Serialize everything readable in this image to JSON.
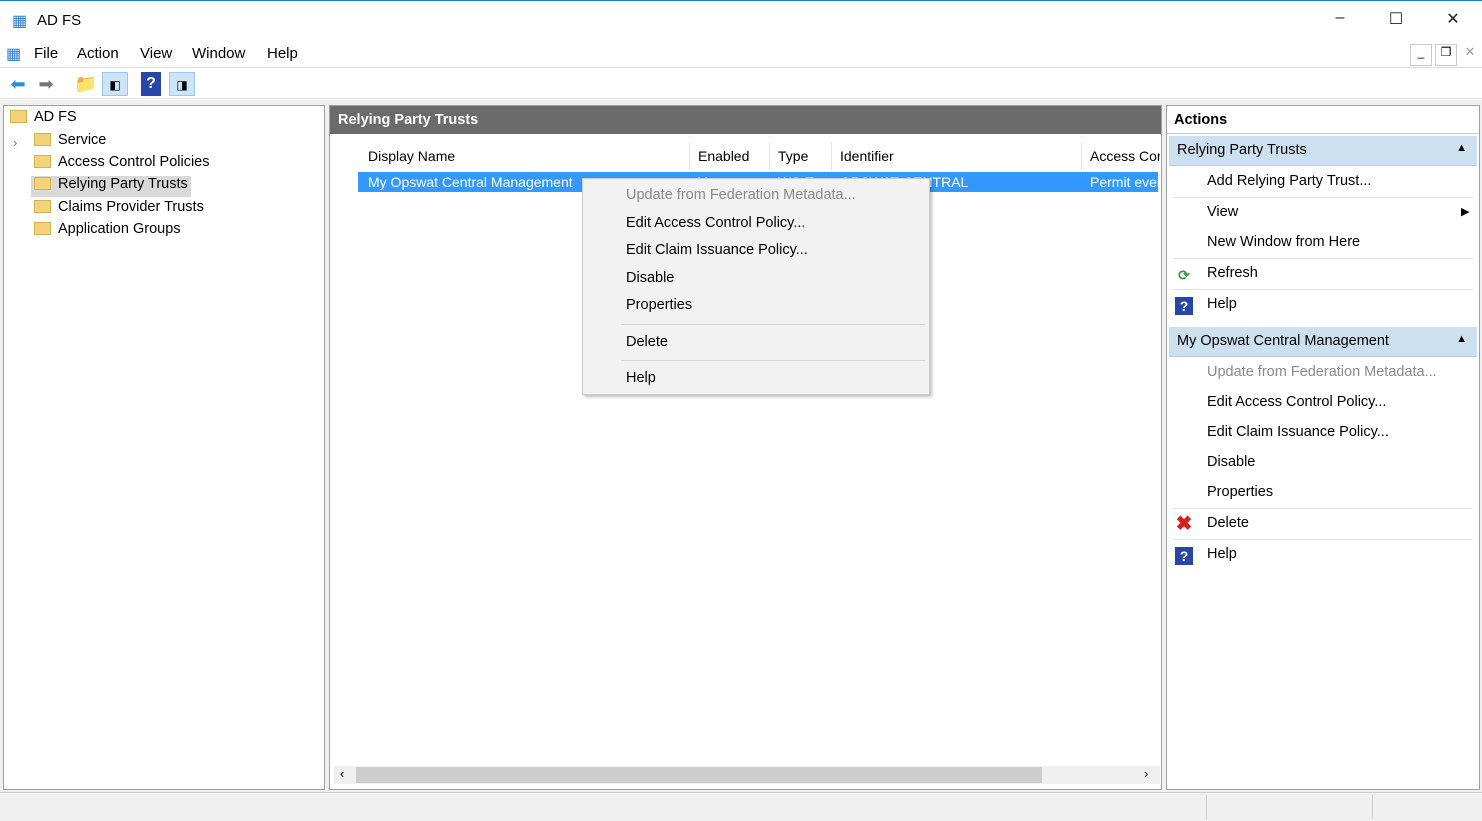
{
  "window": {
    "title": "AD FS",
    "minimize": "–",
    "maximize": "☐",
    "close": "✕"
  },
  "menu": [
    "File",
    "Action",
    "View",
    "Window",
    "Help"
  ],
  "tree": {
    "root": "AD FS",
    "items": [
      "Service",
      "Access Control Policies",
      "Relying Party Trusts",
      "Claims Provider Trusts",
      "Application Groups"
    ],
    "selected": "Relying Party Trusts"
  },
  "center": {
    "title": "Relying Party Trusts",
    "columns": [
      "Display Name",
      "Enabled",
      "Type",
      "Identifier",
      "Access Cor"
    ],
    "row": {
      "name": "My Opswat Central Management",
      "enabled": "Yes",
      "type": "WS-T",
      "identifier": "OPSWAT-CENTRAL",
      "access": "Permit ever"
    }
  },
  "context_menu": {
    "items": [
      "Update from Federation Metadata...",
      "Edit Access Control Policy...",
      "Edit Claim Issuance Policy...",
      "Disable",
      "Properties",
      "Delete",
      "Help"
    ]
  },
  "actions": {
    "title": "Actions",
    "section1": {
      "title": "Relying Party Trusts",
      "items": [
        "Add Relying Party Trust...",
        "View",
        "New Window from Here",
        "Refresh",
        "Help"
      ]
    },
    "section2": {
      "title": "My Opswat Central Management",
      "items": [
        "Update from Federation Metadata...",
        "Edit Access Control Policy...",
        "Edit Claim Issuance Policy...",
        "Disable",
        "Properties",
        "Delete",
        "Help"
      ]
    }
  },
  "colors": {
    "selection": "#3399ff",
    "header": "#6b6b6b",
    "action_header": "#cde0f0"
  }
}
